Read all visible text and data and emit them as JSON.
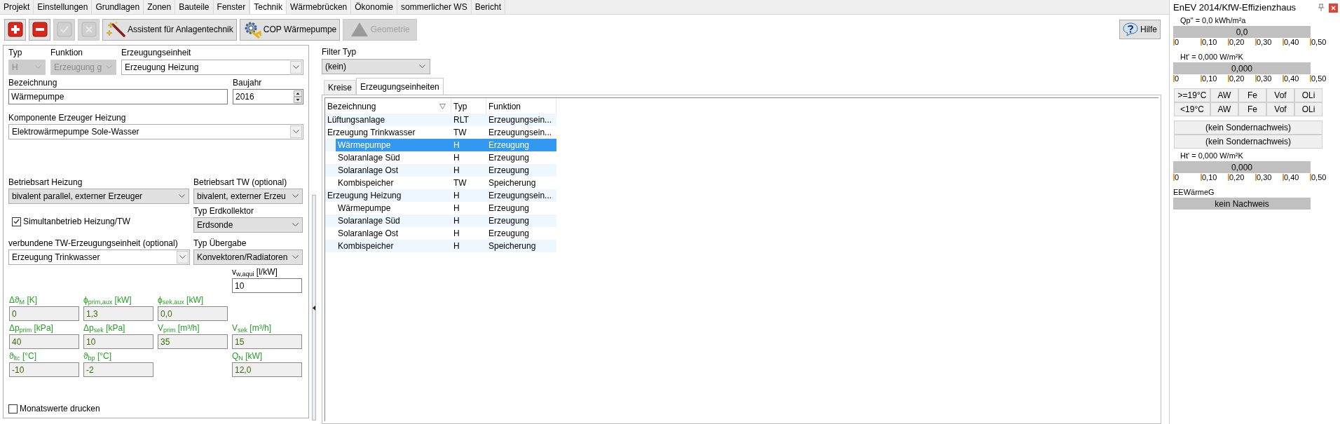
{
  "tabs": [
    {
      "label": "Projekt",
      "selected": false
    },
    {
      "label": "Einstellungen",
      "selected": false
    },
    {
      "label": "Grundlagen",
      "selected": false
    },
    {
      "label": "Zonen",
      "selected": false
    },
    {
      "label": "Bauteile",
      "selected": false
    },
    {
      "label": "Fenster",
      "selected": false
    },
    {
      "label": "Technik",
      "selected": true
    },
    {
      "label": "Wärmebrücken",
      "selected": false
    },
    {
      "label": "Ökonomie",
      "selected": false
    },
    {
      "label": "sommerlicher WS",
      "selected": false
    },
    {
      "label": "Bericht",
      "selected": false
    }
  ],
  "toolbar": [
    {
      "kind": "add",
      "disabled": false
    },
    {
      "kind": "remove",
      "disabled": false
    },
    {
      "kind": "confirm",
      "disabled": true
    },
    {
      "kind": "cancel",
      "disabled": true
    },
    {
      "kind": "wizard",
      "label": "Assistent für Anlagentechnik",
      "disabled": false
    },
    {
      "kind": "gear",
      "label": "COP Wärmepumpe",
      "disabled": false
    },
    {
      "kind": "geometry",
      "label": "Geometrie",
      "disabled": true
    }
  ],
  "help_button": {
    "label": "Hilfe"
  },
  "form": {
    "typ": {
      "label": "Typ",
      "value": "H",
      "kind": "dropdown",
      "disabled": true
    },
    "funktion": {
      "label": "Funktion",
      "value": "Erzeugung g",
      "kind": "dropdown",
      "disabled": true
    },
    "erzeugungseinheit": {
      "label": "Erzeugungseinheit",
      "value": "Erzeugung Heizung",
      "kind": "combo",
      "disabled": false
    },
    "bezeichnung": {
      "label": "Bezeichnung",
      "value": "Wärmepumpe"
    },
    "baujahr": {
      "label": "Baujahr",
      "value": "2016"
    },
    "komponente": {
      "label": "Komponente Erzeuger Heizung",
      "value": "Elektrowärmepumpe Sole-Wasser",
      "kind": "combo",
      "disabled": false
    },
    "betriebsart_heizung": {
      "label": "Betriebsart Heizung",
      "value": "bivalent parallel, externer Erzeuger",
      "kind": "dropdown",
      "disabled": false
    },
    "betriebsart_tw": {
      "label": "Betriebsart TW (optional)",
      "value": "bivalent, externer Erzeu",
      "kind": "dropdown",
      "disabled": false
    },
    "typ_erdkollektor": {
      "label": "Typ Erdkollektor",
      "value": "Erdsonde",
      "kind": "dropdown",
      "disabled": false
    },
    "simultanbetrieb": {
      "label": "Simultanbetrieb Heizung/TW",
      "checked": true
    },
    "tw_einheit": {
      "label": "verbundene TW-Erzeugungseinheit (optional)",
      "value": "Erzeugung Trinkwasser",
      "kind": "combo",
      "disabled": false
    },
    "typ_uebergabe": {
      "label": "Typ Übergabe",
      "value": "Konvektoren/Radiatoren",
      "kind": "dropdown",
      "disabled": false
    },
    "param_rows": [
      {
        "right": [
          {
            "label": "v$_{w,aqui}$ [l/kW]",
            "value": "10",
            "kind": "input"
          }
        ]
      },
      {
        "left": [
          {
            "label": "Δϑ$_{M}$ [K]",
            "value": "0",
            "kind": "computed"
          },
          {
            "label": "ϕ$_{prim,aux}$ [kW]",
            "value": "1,3",
            "kind": "computed"
          },
          {
            "label": "ϕ$_{sek,aux}$ [kW]",
            "value": "0,0",
            "kind": "computed"
          }
        ]
      },
      {
        "left": [
          {
            "label": "Δp$_{prim}$ [kPa]",
            "value": "40",
            "kind": "computed"
          },
          {
            "label": "Δp$_{sek}$ [kPa]",
            "value": "10",
            "kind": "computed"
          },
          {
            "label": "V$_{prim}$ [m³/h]",
            "value": "35",
            "kind": "computed"
          }
        ],
        "right": [
          {
            "label": "V$_{sek}$ [m³/h]",
            "value": "15",
            "kind": "computed"
          }
        ]
      },
      {
        "left": [
          {
            "label": "ϑ$_{ltc}$ [°C]",
            "value": "-10",
            "kind": "computed"
          },
          {
            "label": "ϑ$_{bp}$ [°C]",
            "value": "-2",
            "kind": "computed"
          }
        ],
        "right": [
          {
            "label": "Q$_{N}$ [kW]",
            "value": "12,0",
            "kind": "computed"
          }
        ]
      }
    ],
    "monatswerte": {
      "label": "Monatswerte drucken",
      "checked": false
    }
  },
  "filter": {
    "label": "Filter Typ",
    "value": "(kein)"
  },
  "list_tabs": [
    {
      "label": "Kreise",
      "selected": false
    },
    {
      "label": "Erzeugungseinheiten",
      "selected": true
    }
  ],
  "table": {
    "columns": [
      {
        "label": "Bezeichnung",
        "filter": true
      },
      {
        "label": "Typ",
        "filter": false
      },
      {
        "label": "Funktion",
        "filter": false
      }
    ],
    "rows": [
      {
        "name": "Lüftungsanlage",
        "typ": "RLT",
        "funktion": "Erzeugungsein...",
        "selected": false
      },
      {
        "name": "Erzeugung Trinkwasser",
        "typ": "TW",
        "funktion": "Erzeugungsein...",
        "selected": false,
        "children": [
          {
            "name": "Wärmepumpe",
            "typ": "H",
            "funktion": "Erzeugung",
            "selected": true
          },
          {
            "name": "Solaranlage Süd",
            "typ": "H",
            "funktion": "Erzeugung",
            "selected": false
          },
          {
            "name": "Solaranlage Ost",
            "typ": "H",
            "funktion": "Erzeugung",
            "selected": false
          },
          {
            "name": "Kombispeicher",
            "typ": "TW",
            "funktion": "Speicherung",
            "selected": false
          }
        ]
      },
      {
        "name": "Erzeugung Heizung",
        "typ": "H",
        "funktion": "Erzeugungsein...",
        "selected": false,
        "children": [
          {
            "name": "Wärmepumpe",
            "typ": "H",
            "funktion": "Erzeugung",
            "selected": false
          },
          {
            "name": "Solaranlage Süd",
            "typ": "H",
            "funktion": "Erzeugung",
            "selected": false
          },
          {
            "name": "Solaranlage Ost",
            "typ": "H",
            "funktion": "Erzeugung",
            "selected": false
          },
          {
            "name": "Kombispeicher",
            "typ": "H",
            "funktion": "Speicherung",
            "selected": false
          }
        ]
      }
    ]
  },
  "side_panel": {
    "title": "EnEV 2014/KfW-Effizienzhaus",
    "sections": [
      {
        "kind": "meter",
        "caption": "Qp\" = 0,0 kWh/m²a",
        "value": "0,0",
        "scale": [
          "0",
          "0,10",
          "0,20",
          "0,30",
          "0,40",
          "0,50"
        ]
      },
      {
        "kind": "meter",
        "caption": "Ht' = 0,000 W/m²K",
        "value": "0,000",
        "scale": [
          "0",
          "0,10",
          "0,20",
          "0,30",
          "0,40",
          "0,50"
        ]
      },
      {
        "kind": "zone_table",
        "rows": [
          {
            "label": ">=19°C",
            "cells": [
              "AW",
              "Fe",
              "Vof",
              "OLi"
            ]
          },
          {
            "label": "<19°C",
            "cells": [
              "AW",
              "Fe",
              "Vof",
              "OLi"
            ]
          }
        ]
      },
      {
        "kind": "buttons",
        "labels": [
          "(kein Sondernachweis)",
          "(kein Sondernachweis)"
        ]
      },
      {
        "kind": "meter",
        "caption": "Ht' = 0,000 W/m²K",
        "value": "0,000",
        "scale": [
          "0",
          "0,10",
          "0,20",
          "0,30",
          "0,40",
          "0,50"
        ]
      },
      {
        "kind": "status",
        "caption": "EEWärmeG",
        "value": "kein Nachweis"
      }
    ]
  }
}
